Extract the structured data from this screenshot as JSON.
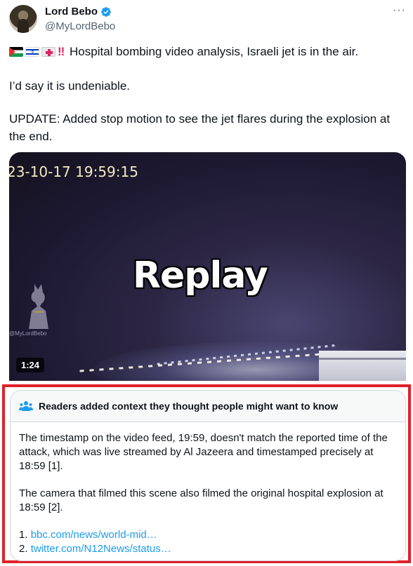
{
  "author": {
    "display_name": "Lord Bebo",
    "handle": "@MyLordBebo",
    "verified": true,
    "more_label": "···"
  },
  "tweet": {
    "flag_icons": [
      "palestine-flag-icon",
      "israel-flag-icon",
      "hospital-icon"
    ],
    "emphasis": "‼",
    "line1": "Hospital bombing video analysis, Israeli jet is in the air.",
    "line2": "I’d say it is undeniable.",
    "line3": "UPDATE: Added stop motion to see the jet flares during the explosion at the end."
  },
  "media": {
    "timestamp_overlay": "23-10-17  19:59:15",
    "replay_label": "Replay",
    "watermark": "@MyLordBebo",
    "duration": "1:24"
  },
  "community_note": {
    "header": "Readers added context they thought people might want to know",
    "paragraph1": "The timestamp on the video feed, 19:59, doesn't match the reported time of the attack, which was live streamed by Al Jazeera and timestamped precisely at 18:59 [1].",
    "paragraph2": "The camera that filmed this scene also filmed the original hospital explosion at 18:59 [2].",
    "links": [
      {
        "number": "1.",
        "text": "bbc.com/news/world-mid…"
      },
      {
        "number": "2.",
        "text": "twitter.com/N12News/status…"
      }
    ],
    "highlight_color": "#e0202a",
    "link_color": "#1d9bf0"
  }
}
